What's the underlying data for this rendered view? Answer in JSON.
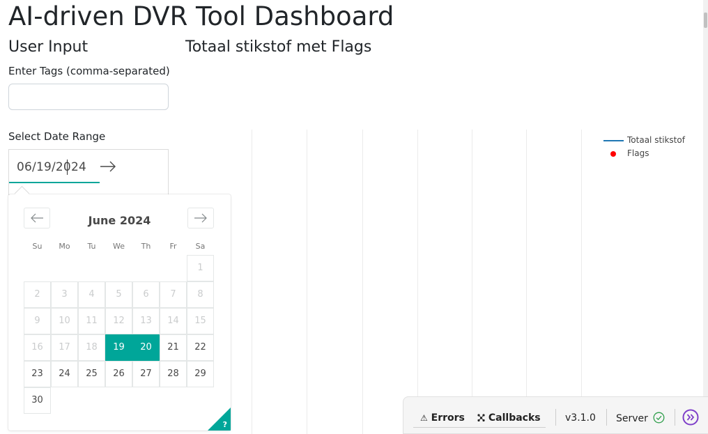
{
  "page": {
    "title": "AI-driven DVR Tool Dashboard"
  },
  "user_input": {
    "heading": "User Input",
    "tags_label": "Enter Tags (comma-separated)",
    "tags_value": "",
    "tags_placeholder": "",
    "date_label": "Select Date Range",
    "start_date": "06/19/2024",
    "end_date": ""
  },
  "calendar": {
    "month": "June 2024",
    "weekdays": [
      "Su",
      "Mo",
      "Tu",
      "We",
      "Th",
      "Fr",
      "Sa"
    ],
    "days": [
      "1",
      "2",
      "3",
      "4",
      "5",
      "6",
      "7",
      "8",
      "9",
      "10",
      "11",
      "12",
      "13",
      "14",
      "15",
      "16",
      "17",
      "18",
      "19",
      "20",
      "21",
      "22",
      "23",
      "24",
      "25",
      "26",
      "27",
      "28",
      "29",
      "30"
    ],
    "first_weekday_index": 6,
    "blocked_through_day": 18,
    "selected_days": [
      "19",
      "20"
    ],
    "help_glyph": "?"
  },
  "chart": {
    "title": "Totaal stikstof met Flags",
    "legend": [
      {
        "label": "Totaal stikstof",
        "color": "#1f77b4",
        "marker": "line"
      },
      {
        "label": "Flags",
        "color": "#ff0000",
        "marker": "dot"
      }
    ]
  },
  "devtools": {
    "errors_label": "Errors",
    "callbacks_label": "Callbacks",
    "version": "v3.1.0",
    "server_label": "Server",
    "server_status_color": "#2e9e4a",
    "accent_color": "#7e3fc9"
  }
}
